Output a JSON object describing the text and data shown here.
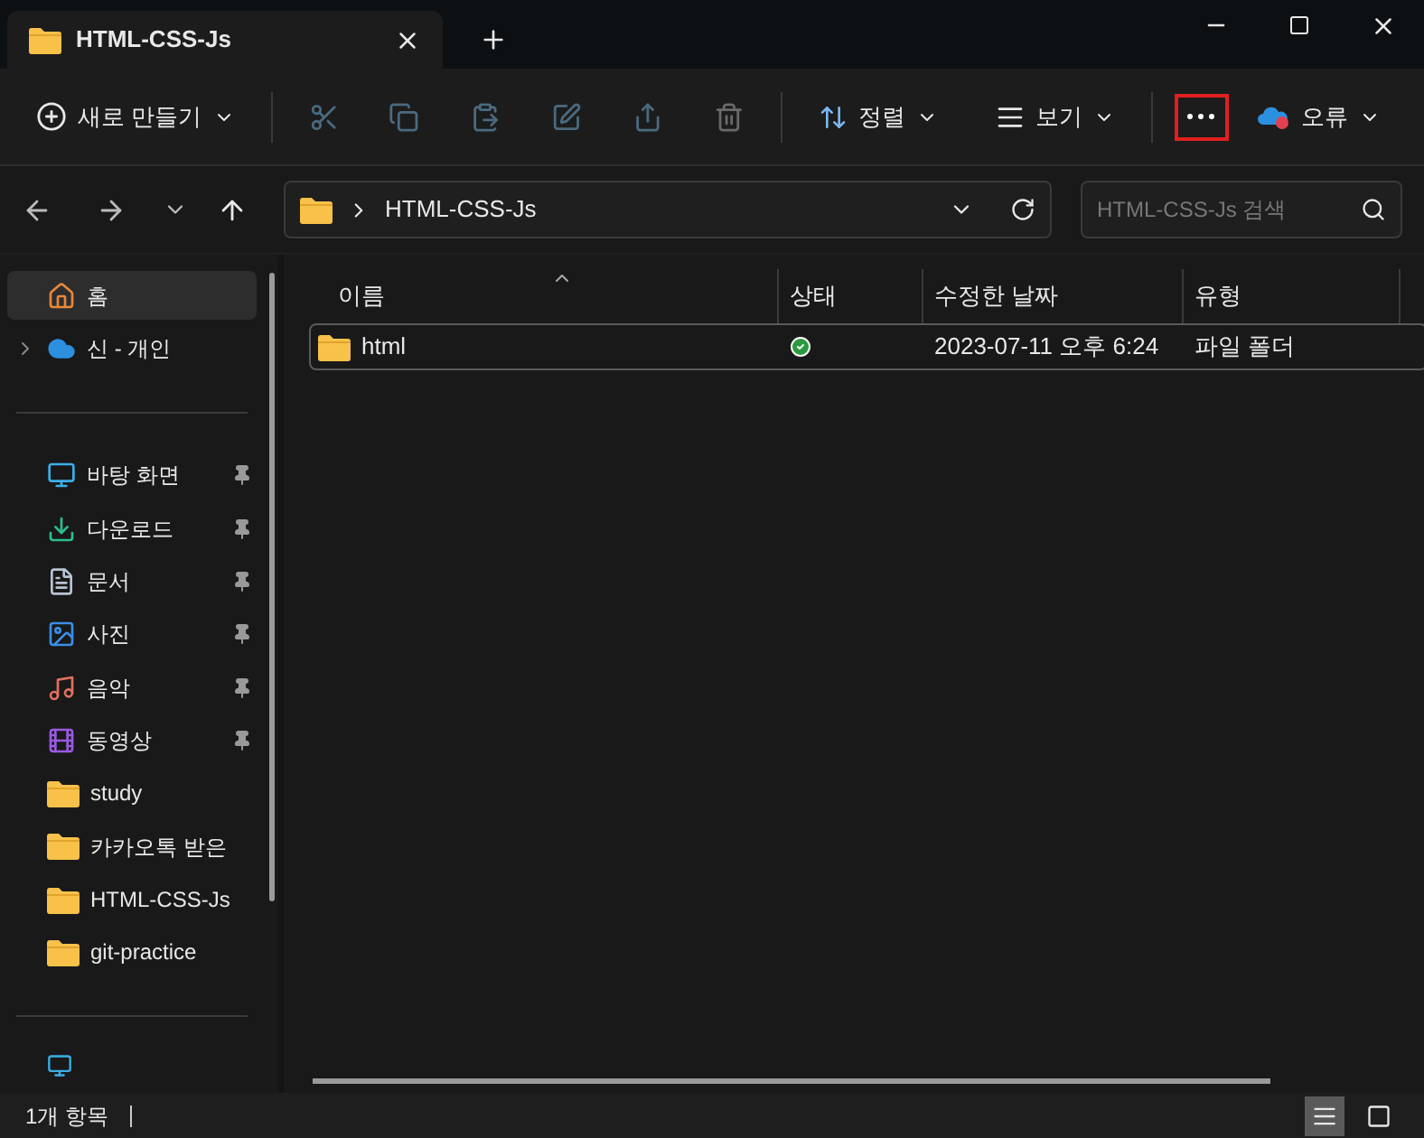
{
  "tab": {
    "title": "HTML-CSS-Js"
  },
  "toolbar": {
    "new_label": "새로 만들기",
    "sort_label": "정렬",
    "view_label": "보기",
    "more_highlighted": true,
    "status_label": "오류"
  },
  "address": {
    "path": "HTML-CSS-Js",
    "search_placeholder": "HTML-CSS-Js 검색"
  },
  "sidebar": {
    "items": [
      {
        "kind": "home",
        "label": "홈",
        "selected": true,
        "pinned": false,
        "expandable": false
      },
      {
        "kind": "cloud",
        "label": "신 - 개인",
        "selected": false,
        "pinned": false,
        "expandable": true
      },
      {
        "kind": "divider"
      },
      {
        "kind": "desktop",
        "label": "바탕 화면",
        "selected": false,
        "pinned": true,
        "expandable": false
      },
      {
        "kind": "download",
        "label": "다운로드",
        "selected": false,
        "pinned": true,
        "expandable": false
      },
      {
        "kind": "document",
        "label": "문서",
        "selected": false,
        "pinned": true,
        "expandable": false
      },
      {
        "kind": "picture",
        "label": "사진",
        "selected": false,
        "pinned": true,
        "expandable": false
      },
      {
        "kind": "music",
        "label": "음악",
        "selected": false,
        "pinned": true,
        "expandable": false
      },
      {
        "kind": "video",
        "label": "동영상",
        "selected": false,
        "pinned": true,
        "expandable": false
      },
      {
        "kind": "folder",
        "label": "study",
        "selected": false,
        "pinned": false,
        "expandable": false
      },
      {
        "kind": "folder",
        "label": "카카오톡 받은",
        "selected": false,
        "pinned": false,
        "expandable": false
      },
      {
        "kind": "folder",
        "label": "HTML-CSS-Js",
        "selected": false,
        "pinned": false,
        "expandable": false
      },
      {
        "kind": "folder",
        "label": "git-practice",
        "selected": false,
        "pinned": false,
        "expandable": false
      },
      {
        "kind": "divider"
      }
    ]
  },
  "table": {
    "columns": [
      "이름",
      "상태",
      "수정한 날짜",
      "유형"
    ],
    "rows": [
      {
        "name": "html",
        "synced": true,
        "modified": "2023-07-11 오후 6:24",
        "type": "파일 폴더",
        "selected": true
      }
    ]
  },
  "status_bar": {
    "count": "1개 항목",
    "view_details_selected": true
  }
}
